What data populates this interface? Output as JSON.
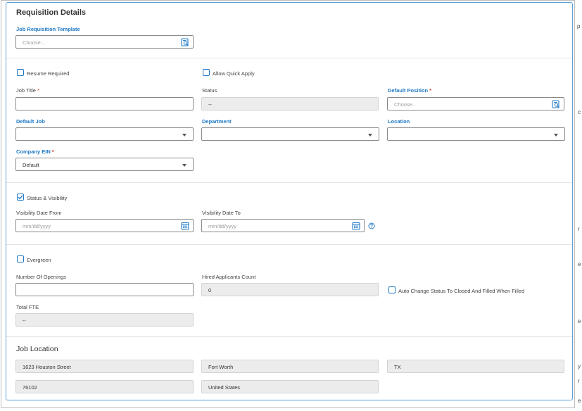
{
  "backdrop": {
    "edge_letters": [
      "p",
      "c",
      "r",
      "e",
      "e",
      "y",
      "r",
      "e"
    ]
  },
  "requisition": {
    "title": "Requisition Details",
    "template": {
      "label": "Job Requisition Template",
      "placeholder": "Choose..."
    },
    "resume_required": {
      "label": "Resume Required",
      "checked": false
    },
    "allow_quick_apply": {
      "label": "Allow Quick Apply",
      "checked": false
    },
    "job_title": {
      "label": "Job Title",
      "required": "*",
      "value": ""
    },
    "status": {
      "label": "Status",
      "value": "--"
    },
    "default_position": {
      "label": "Default Position",
      "required": "*",
      "placeholder": "Choose..."
    },
    "default_job": {
      "label": "Default Job",
      "value": ""
    },
    "department": {
      "label": "Department",
      "value": ""
    },
    "location": {
      "label": "Location",
      "value": ""
    },
    "company_ein": {
      "label": "Company EIN",
      "required": "*",
      "value": "Default"
    },
    "status_visibility": {
      "label": "Status & Visibility",
      "checked": true
    },
    "visibility_from": {
      "label": "Visibility Date From",
      "placeholder": "mm/dd/yyyy"
    },
    "visibility_to": {
      "label": "Visibility Date To",
      "placeholder": "mm/dd/yyyy"
    },
    "evergreen": {
      "label": "Evergreen",
      "checked": false
    },
    "openings": {
      "label": "Number Of Openings",
      "value": ""
    },
    "hired_count": {
      "label": "Hired Applicants Count",
      "value": "0"
    },
    "auto_change": {
      "label": "Auto Change Status To Closed And Filled When Filled",
      "checked": false
    },
    "total_fte": {
      "label": "Total FTE",
      "value": "--"
    }
  },
  "job_location": {
    "title": "Job Location",
    "street": "1623 Houston Street",
    "city": "Fort Worth",
    "state": "TX",
    "zip": "76102",
    "country": "United States"
  },
  "colors": {
    "accent": "#1f79c6",
    "required": "#d32f2f",
    "readonly_bg": "#ececec",
    "card_border": "#5aa0d8"
  }
}
